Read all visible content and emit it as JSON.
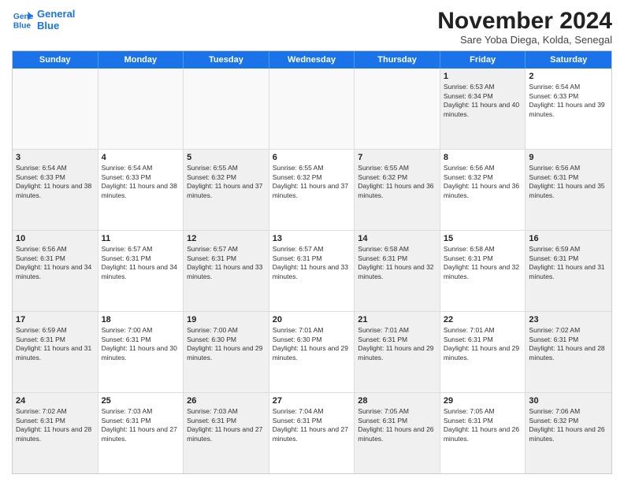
{
  "logo": {
    "line1": "General",
    "line2": "Blue"
  },
  "title": "November 2024",
  "location": "Sare Yoba Diega, Kolda, Senegal",
  "weekdays": [
    "Sunday",
    "Monday",
    "Tuesday",
    "Wednesday",
    "Thursday",
    "Friday",
    "Saturday"
  ],
  "rows": [
    [
      {
        "day": "",
        "text": "",
        "empty": true
      },
      {
        "day": "",
        "text": "",
        "empty": true
      },
      {
        "day": "",
        "text": "",
        "empty": true
      },
      {
        "day": "",
        "text": "",
        "empty": true
      },
      {
        "day": "",
        "text": "",
        "empty": true
      },
      {
        "day": "1",
        "text": "Sunrise: 6:53 AM\nSunset: 6:34 PM\nDaylight: 11 hours and 40 minutes.",
        "shaded": true
      },
      {
        "day": "2",
        "text": "Sunrise: 6:54 AM\nSunset: 6:33 PM\nDaylight: 11 hours and 39 minutes."
      }
    ],
    [
      {
        "day": "3",
        "text": "Sunrise: 6:54 AM\nSunset: 6:33 PM\nDaylight: 11 hours and 38 minutes.",
        "shaded": true
      },
      {
        "day": "4",
        "text": "Sunrise: 6:54 AM\nSunset: 6:33 PM\nDaylight: 11 hours and 38 minutes."
      },
      {
        "day": "5",
        "text": "Sunrise: 6:55 AM\nSunset: 6:32 PM\nDaylight: 11 hours and 37 minutes.",
        "shaded": true
      },
      {
        "day": "6",
        "text": "Sunrise: 6:55 AM\nSunset: 6:32 PM\nDaylight: 11 hours and 37 minutes."
      },
      {
        "day": "7",
        "text": "Sunrise: 6:55 AM\nSunset: 6:32 PM\nDaylight: 11 hours and 36 minutes.",
        "shaded": true
      },
      {
        "day": "8",
        "text": "Sunrise: 6:56 AM\nSunset: 6:32 PM\nDaylight: 11 hours and 36 minutes."
      },
      {
        "day": "9",
        "text": "Sunrise: 6:56 AM\nSunset: 6:31 PM\nDaylight: 11 hours and 35 minutes.",
        "shaded": true
      }
    ],
    [
      {
        "day": "10",
        "text": "Sunrise: 6:56 AM\nSunset: 6:31 PM\nDaylight: 11 hours and 34 minutes.",
        "shaded": true
      },
      {
        "day": "11",
        "text": "Sunrise: 6:57 AM\nSunset: 6:31 PM\nDaylight: 11 hours and 34 minutes."
      },
      {
        "day": "12",
        "text": "Sunrise: 6:57 AM\nSunset: 6:31 PM\nDaylight: 11 hours and 33 minutes.",
        "shaded": true
      },
      {
        "day": "13",
        "text": "Sunrise: 6:57 AM\nSunset: 6:31 PM\nDaylight: 11 hours and 33 minutes."
      },
      {
        "day": "14",
        "text": "Sunrise: 6:58 AM\nSunset: 6:31 PM\nDaylight: 11 hours and 32 minutes.",
        "shaded": true
      },
      {
        "day": "15",
        "text": "Sunrise: 6:58 AM\nSunset: 6:31 PM\nDaylight: 11 hours and 32 minutes."
      },
      {
        "day": "16",
        "text": "Sunrise: 6:59 AM\nSunset: 6:31 PM\nDaylight: 11 hours and 31 minutes.",
        "shaded": true
      }
    ],
    [
      {
        "day": "17",
        "text": "Sunrise: 6:59 AM\nSunset: 6:31 PM\nDaylight: 11 hours and 31 minutes.",
        "shaded": true
      },
      {
        "day": "18",
        "text": "Sunrise: 7:00 AM\nSunset: 6:31 PM\nDaylight: 11 hours and 30 minutes."
      },
      {
        "day": "19",
        "text": "Sunrise: 7:00 AM\nSunset: 6:30 PM\nDaylight: 11 hours and 29 minutes.",
        "shaded": true
      },
      {
        "day": "20",
        "text": "Sunrise: 7:01 AM\nSunset: 6:30 PM\nDaylight: 11 hours and 29 minutes."
      },
      {
        "day": "21",
        "text": "Sunrise: 7:01 AM\nSunset: 6:31 PM\nDaylight: 11 hours and 29 minutes.",
        "shaded": true
      },
      {
        "day": "22",
        "text": "Sunrise: 7:01 AM\nSunset: 6:31 PM\nDaylight: 11 hours and 29 minutes."
      },
      {
        "day": "23",
        "text": "Sunrise: 7:02 AM\nSunset: 6:31 PM\nDaylight: 11 hours and 28 minutes.",
        "shaded": true
      }
    ],
    [
      {
        "day": "24",
        "text": "Sunrise: 7:02 AM\nSunset: 6:31 PM\nDaylight: 11 hours and 28 minutes.",
        "shaded": true
      },
      {
        "day": "25",
        "text": "Sunrise: 7:03 AM\nSunset: 6:31 PM\nDaylight: 11 hours and 27 minutes."
      },
      {
        "day": "26",
        "text": "Sunrise: 7:03 AM\nSunset: 6:31 PM\nDaylight: 11 hours and 27 minutes.",
        "shaded": true
      },
      {
        "day": "27",
        "text": "Sunrise: 7:04 AM\nSunset: 6:31 PM\nDaylight: 11 hours and 27 minutes."
      },
      {
        "day": "28",
        "text": "Sunrise: 7:05 AM\nSunset: 6:31 PM\nDaylight: 11 hours and 26 minutes.",
        "shaded": true
      },
      {
        "day": "29",
        "text": "Sunrise: 7:05 AM\nSunset: 6:31 PM\nDaylight: 11 hours and 26 minutes."
      },
      {
        "day": "30",
        "text": "Sunrise: 7:06 AM\nSunset: 6:32 PM\nDaylight: 11 hours and 26 minutes.",
        "shaded": true
      }
    ]
  ]
}
